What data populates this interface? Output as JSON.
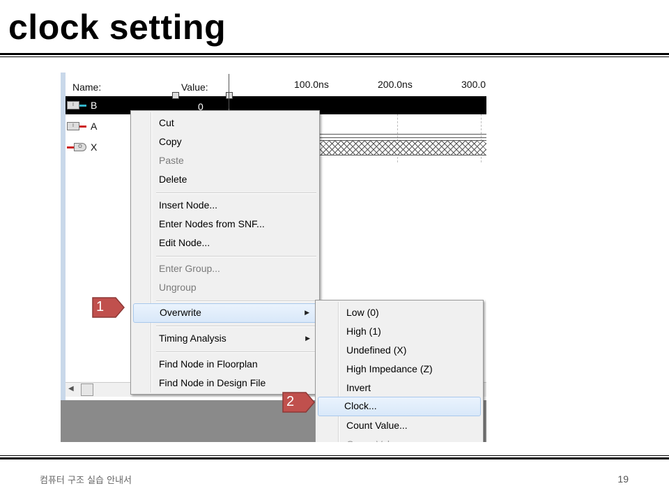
{
  "slide": {
    "title": "clock setting",
    "footer": "컴퓨터 구조 실습 안내서",
    "page_number": "19"
  },
  "waveform": {
    "columns": {
      "name": "Name:",
      "value": "Value:"
    },
    "time_marks": [
      "100.0ns",
      "200.0ns",
      "300.0"
    ],
    "nodes": [
      {
        "name": "B",
        "type": "input",
        "value": "0",
        "selected": true,
        "lead_color": "#33b3c8"
      },
      {
        "name": "A",
        "type": "input",
        "value": "",
        "selected": false,
        "lead_color": "#cc2222"
      },
      {
        "name": "X",
        "type": "output",
        "value": "",
        "selected": false,
        "lead_color": "#cc2222"
      }
    ]
  },
  "context_menu": {
    "items": [
      {
        "label": "Cut",
        "enabled": true
      },
      {
        "label": "Copy",
        "enabled": true
      },
      {
        "label": "Paste",
        "enabled": false
      },
      {
        "label": "Delete",
        "enabled": true
      },
      {
        "label": "Insert Node...",
        "enabled": true
      },
      {
        "label": "Enter Nodes from SNF...",
        "enabled": true
      },
      {
        "label": "Edit Node...",
        "enabled": true
      },
      {
        "label": "Enter Group...",
        "enabled": false
      },
      {
        "label": "Ungroup",
        "enabled": false
      },
      {
        "label": "Overwrite",
        "enabled": true,
        "submenu": true,
        "highlighted": true
      },
      {
        "label": "Timing Analysis",
        "enabled": true,
        "submenu": true
      },
      {
        "label": "Find Node in Floorplan",
        "enabled": true
      },
      {
        "label": "Find Node in Design File",
        "enabled": true
      }
    ]
  },
  "submenu": {
    "items": [
      {
        "label": "Low (0)"
      },
      {
        "label": "High (1)"
      },
      {
        "label": "Undefined (X)"
      },
      {
        "label": "High Impedance (Z)"
      },
      {
        "label": "Invert"
      },
      {
        "label": "Clock...",
        "highlighted": true
      },
      {
        "label": "Count Value..."
      },
      {
        "label": "Group Value..."
      }
    ]
  },
  "callouts": [
    {
      "label": "1",
      "color": "#c0504d"
    },
    {
      "label": "2",
      "color": "#c0504d"
    }
  ]
}
